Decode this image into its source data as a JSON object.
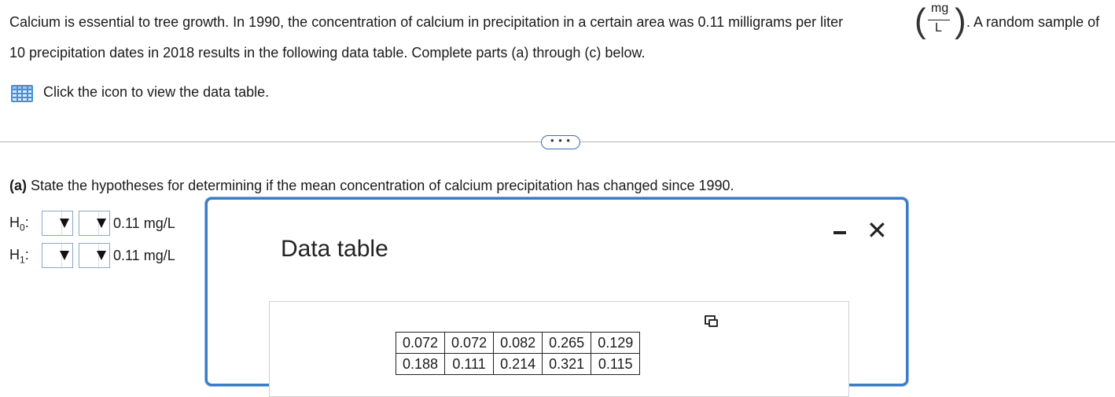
{
  "prompt": {
    "line1_text": "Calcium is essential to tree growth. In 1990, the concentration of calcium in precipitation in a certain area was 0.11 milligrams per liter",
    "unit_numerator": "mg",
    "unit_denominator": "L",
    "line1_tail": ". A random sample of",
    "line2_text": "10 precipitation dates in 2018 results in the following data table. Complete parts (a) through (c) below."
  },
  "data_table_link": {
    "icon": "table-grid-icon",
    "label": "Click the icon to view the data table."
  },
  "expander": {
    "label": "• • •"
  },
  "part_a": {
    "label": "(a)",
    "question": "State the hypotheses for determining if the mean concentration of calcium precipitation has changed since 1990."
  },
  "hypotheses": [
    {
      "symbol": "H",
      "subscript": "0",
      "colon": ":",
      "value": "0.11 mg/L"
    },
    {
      "symbol": "H",
      "subscript": "1",
      "colon": ":",
      "value": "0.11 mg/L"
    }
  ],
  "dialog": {
    "title": "Data table",
    "minimize_icon": "minimize-icon",
    "close_icon": "close-icon",
    "close_glyph": "✕",
    "copy_icon": "copy-icon",
    "table_rows": [
      [
        "0.072",
        "0.072",
        "0.082",
        "0.265",
        "0.129"
      ],
      [
        "0.188",
        "0.111",
        "0.214",
        "0.321",
        "0.115"
      ]
    ]
  },
  "colors": {
    "accent": "#3a7bc4",
    "icon_blue": "#4a8fd6"
  }
}
